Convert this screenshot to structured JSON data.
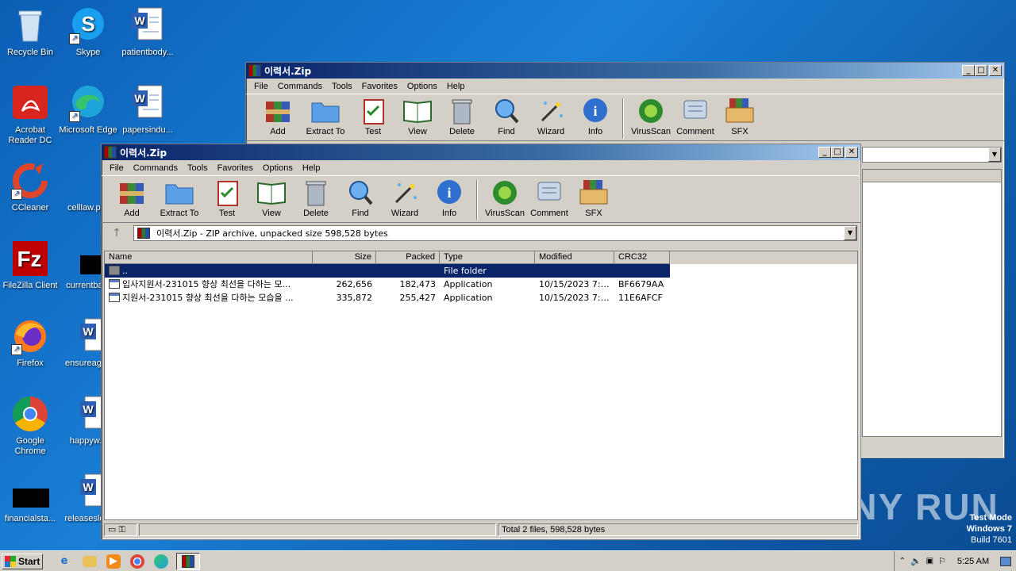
{
  "desktop": {
    "icons": [
      {
        "label": "Recycle Bin"
      },
      {
        "label": "Skype"
      },
      {
        "label": "patientbody..."
      },
      {
        "label": "Acrobat Reader DC"
      },
      {
        "label": "Microsoft Edge"
      },
      {
        "label": "papersindu..."
      },
      {
        "label": "CCleaner"
      },
      {
        "label": "celllaw.p..."
      },
      {
        "label": "FileZilla Client"
      },
      {
        "label": "currentba..."
      },
      {
        "label": "Firefox"
      },
      {
        "label": "ensureagr..."
      },
      {
        "label": "Google Chrome"
      },
      {
        "label": "happyw..."
      },
      {
        "label": "financialsta..."
      },
      {
        "label": "releasesle..."
      }
    ]
  },
  "back_window": {
    "title": "이력서.Zip",
    "menu": [
      "File",
      "Commands",
      "Tools",
      "Favorites",
      "Options",
      "Help"
    ],
    "toolbar": [
      "Add",
      "Extract To",
      "Test",
      "View",
      "Delete",
      "Find",
      "Wizard",
      "Info",
      "VirusScan",
      "Comment",
      "SFX"
    ]
  },
  "front_window": {
    "title": "이력서.Zip",
    "menu": [
      "File",
      "Commands",
      "Tools",
      "Favorites",
      "Options",
      "Help"
    ],
    "toolbar": [
      "Add",
      "Extract To",
      "Test",
      "View",
      "Delete",
      "Find",
      "Wizard",
      "Info",
      "VirusScan",
      "Comment",
      "SFX"
    ],
    "address": "이력서.Zip - ZIP archive, unpacked size 598,528 bytes",
    "columns": [
      "Name",
      "Size",
      "Packed",
      "Type",
      "Modified",
      "CRC32"
    ],
    "rows": [
      {
        "name": "..",
        "size": "",
        "packed": "",
        "type": "File folder",
        "modified": "",
        "crc": ""
      },
      {
        "name": "입사지원서-231015 향상 최선을 다하는 모...",
        "size": "262,656",
        "packed": "182,473",
        "type": "Application",
        "modified": "10/15/2023 7:4...",
        "crc": "BF6679AA"
      },
      {
        "name": "지원서-231015 향상 최선을 다하는 모습을 ...",
        "size": "335,872",
        "packed": "255,427",
        "type": "Application",
        "modified": "10/15/2023 7:4...",
        "crc": "11E6AFCF"
      }
    ],
    "status": "Total 2 files, 598,528 bytes"
  },
  "taskbar": {
    "start": "Start",
    "clock": "5:25 AM"
  },
  "watermark": {
    "line1": "Test Mode",
    "line2": "Windows 7",
    "line3": "Build 7601",
    "brand": "ANY RUN"
  }
}
